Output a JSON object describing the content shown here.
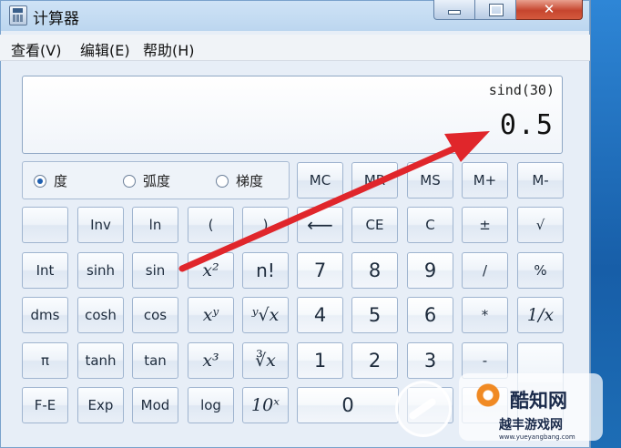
{
  "window": {
    "title": "计算器",
    "close_glyph": "✕"
  },
  "menu": [
    "查看(V)",
    "编辑(E)",
    "帮助(H)"
  ],
  "display": {
    "expression": "sind(30)",
    "value": "0.5"
  },
  "angle_modes": [
    {
      "label": "度",
      "selected": true
    },
    {
      "label": "弧度",
      "selected": false
    },
    {
      "label": "梯度",
      "selected": false
    }
  ],
  "keys": {
    "mc": "MC",
    "mr": "MR",
    "ms": "MS",
    "mplus": "M+",
    "mminus": "M-",
    "inv": "Inv",
    "ln": "ln",
    "lparen": "(",
    "rparen": ")",
    "backspace": "⟵",
    "ce": "CE",
    "c": "C",
    "plusminus": "±",
    "sqrt": "√",
    "int": "Int",
    "sinh": "sinh",
    "sin": "sin",
    "x2": "x²",
    "fact": "n!",
    "seven": "7",
    "eight": "8",
    "nine": "9",
    "div": "/",
    "percent": "%",
    "dms": "dms",
    "cosh": "cosh",
    "cos": "cos",
    "xy": "xʸ",
    "yrootx": "ʸ√x",
    "four": "4",
    "five": "5",
    "six": "6",
    "mul": "*",
    "recip": "1/x",
    "pi": "π",
    "tanh": "tanh",
    "tan": "tan",
    "x3": "x³",
    "cuberoot": "∛x",
    "one": "1",
    "two": "2",
    "three": "3",
    "sub": "-",
    "fe": "F-E",
    "exp": "Exp",
    "mod": "Mod",
    "log": "log",
    "tenx": "10ˣ",
    "zero": "0"
  },
  "watermark": {
    "title": "酷知网",
    "subtitle": "越丰游戏网",
    "url": "www.yueyangbang.com"
  },
  "colors": {
    "arrow": "#e0262b",
    "close_button": "#c6452e",
    "desktop": "#1d6db5"
  }
}
